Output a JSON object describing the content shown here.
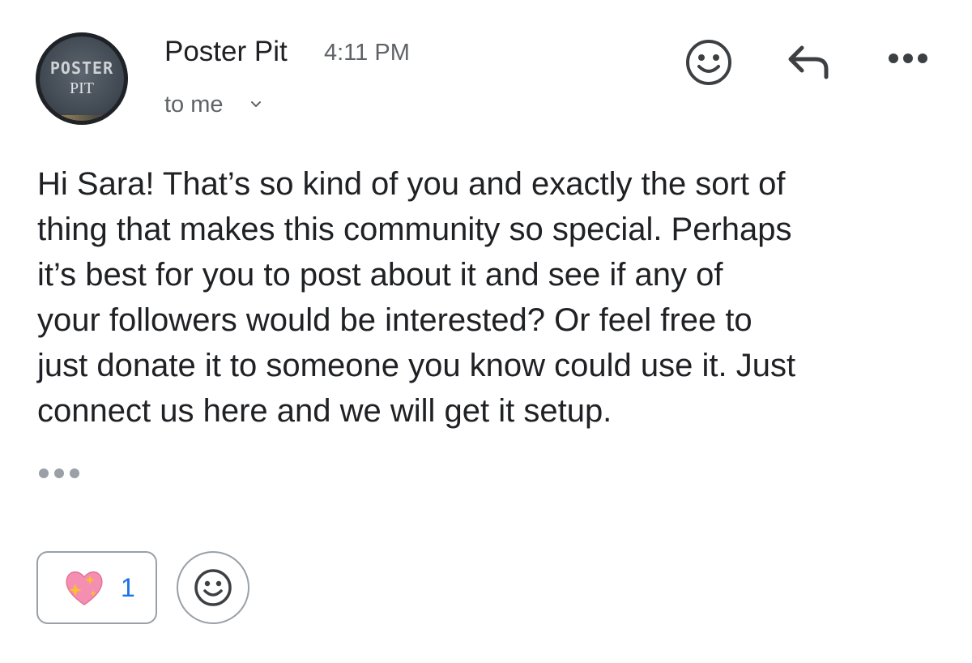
{
  "header": {
    "sender_name": "Poster Pit",
    "time": "4:11 PM",
    "recipient": "to me",
    "avatar": {
      "line1": "POSTER",
      "line2": "PIT"
    },
    "actions": {
      "emoji_icon": "smiley-icon",
      "reply_icon": "reply-arrow-icon",
      "more_icon": "more-horizontal-icon"
    }
  },
  "message": {
    "body_lines": [
      "Hi Sara! That’s so kind of you and exactly the sort of",
      "thing that makes this community so special. Perhaps",
      "it’s best for you to post about it and see if any of",
      "your followers would be interested? Or feel free to",
      "just donate it to someone you know could use it. Just",
      "connect us here and we will get it setup."
    ],
    "quoted_text_icon": "ellipsis-icon"
  },
  "reactions": {
    "items": [
      {
        "emoji": "sparkling-heart-icon",
        "count": "1"
      }
    ],
    "add_reaction_icon": "smiley-icon"
  },
  "colors": {
    "text_primary": "#202124",
    "text_secondary": "#5f6368",
    "count_blue": "#1a73e8",
    "chip_border": "#9aa0a6",
    "heart_pink": "#f48fb1",
    "sparkle_yellow": "#fbc02d"
  }
}
